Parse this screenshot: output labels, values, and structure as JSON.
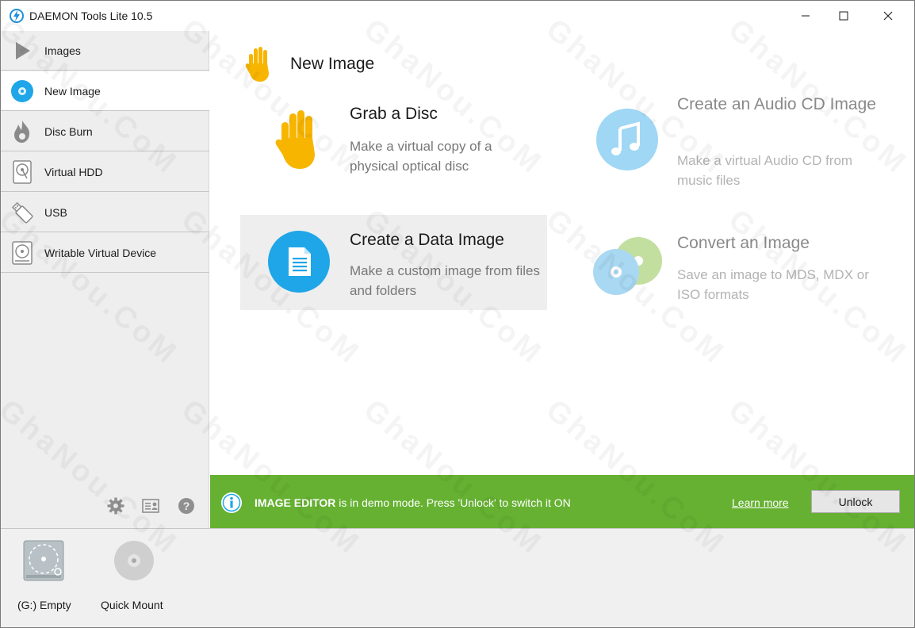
{
  "window": {
    "title": "DAEMON Tools Lite 10.5"
  },
  "sidebar": {
    "items": [
      {
        "label": "Images",
        "icon": "play-icon"
      },
      {
        "label": "New Image",
        "icon": "disc-icon"
      },
      {
        "label": "Disc Burn",
        "icon": "flame-icon"
      },
      {
        "label": "Virtual HDD",
        "icon": "hdd-icon"
      },
      {
        "label": "USB",
        "icon": "usb-icon"
      },
      {
        "label": "Writable Virtual Device",
        "icon": "writable-device-icon"
      }
    ],
    "active_index": 1,
    "tools": [
      "gear-icon",
      "license-icon",
      "help-icon"
    ]
  },
  "main": {
    "title": "New Image",
    "cards": [
      {
        "title": "Grab a Disc",
        "desc": "Make a virtual copy of a physical optical disc",
        "icon": "hand-icon",
        "enabled": true
      },
      {
        "title": "Create an Audio CD Image",
        "desc": "Make a virtual Audio CD from music files",
        "icon": "music-note-icon",
        "enabled": false
      },
      {
        "title": "Create a Data Image",
        "desc": "Make a custom image from files and folders",
        "icon": "document-icon",
        "enabled": true,
        "selected": true
      },
      {
        "title": "Convert an Image",
        "desc": "Save an image to MDS, MDX or ISO formats",
        "icon": "convert-discs-icon",
        "enabled": false
      }
    ]
  },
  "notification": {
    "bold": "IMAGE EDITOR",
    "text": " is in demo mode. Press 'Unlock' to switch it ON",
    "link": "Learn more",
    "button": "Unlock",
    "color": "#66b132"
  },
  "bottombar": {
    "devices": [
      {
        "label": "(G:) Empty",
        "icon": "virtual-drive-icon"
      },
      {
        "label": "Quick Mount",
        "icon": "quick-mount-disc-icon"
      }
    ]
  },
  "watermark": "GhaNou.CoM",
  "colors": {
    "accent": "#1fa6e8",
    "hand": "#f7b500",
    "green_bar": "#66b132"
  }
}
